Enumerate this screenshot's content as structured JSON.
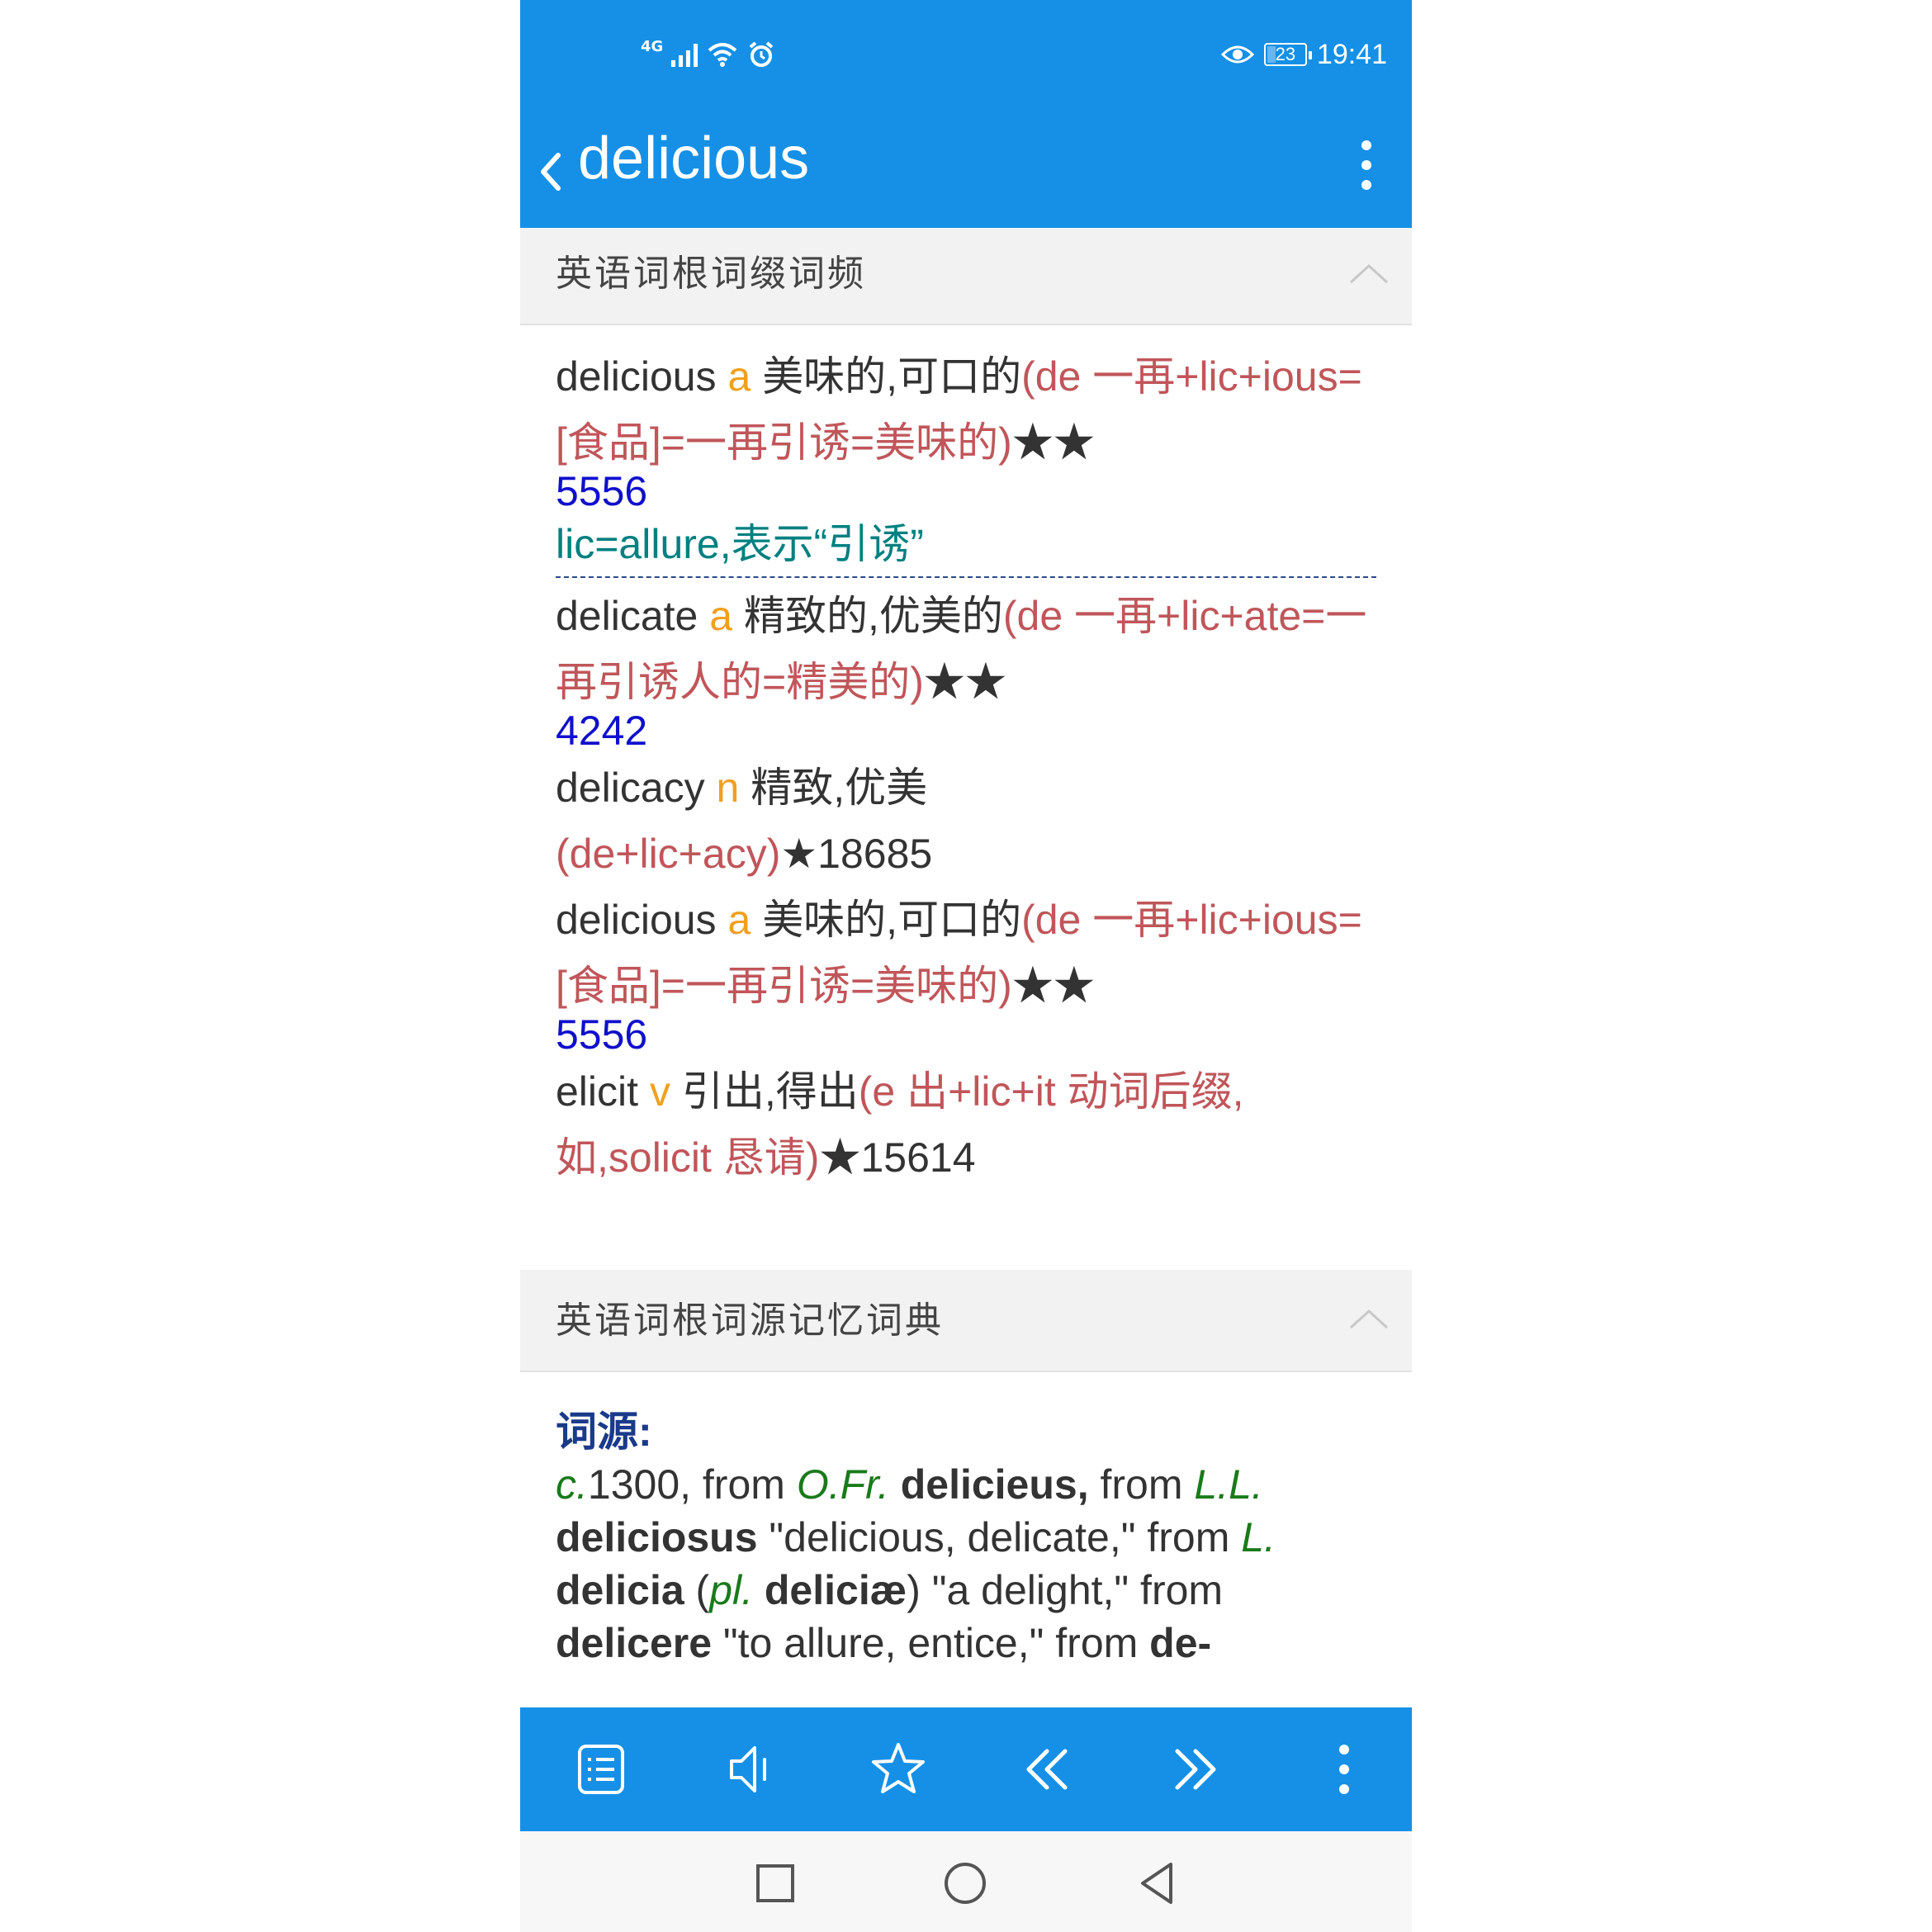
{
  "status_bar": {
    "network": "4G",
    "battery": "23",
    "time": "19:41"
  },
  "app_bar": {
    "title": "delicious"
  },
  "section1": {
    "title": "英语词根词缀词频",
    "entries": [
      {
        "word": "delicious",
        "pos": "a",
        "definition": "美味的,可口的",
        "etymology": "(de 一再+lic+ious=[食品]=一再引诱=美味的)",
        "stars": "★★",
        "frequency": "5556",
        "note": "lic=allure,表示“引诱”"
      },
      {
        "word": "delicate",
        "pos": "a",
        "definition": "精致的,优美的",
        "etymology": "(de 一再+lic+ate=一再引诱人的=精美的)",
        "stars": "★★",
        "frequency": "4242"
      },
      {
        "word": "delicacy",
        "pos": "n",
        "definition": "精致,优美",
        "etymology": "(de+lic+acy)",
        "stars": "★18685"
      },
      {
        "word": "delicious",
        "pos": "a",
        "definition": "美味的,可口的",
        "etymology": "(de 一再+lic+ious=[食品]=一再引诱=美味的)",
        "stars": "★★",
        "frequency": "5556"
      },
      {
        "word": "elicit",
        "pos": "v",
        "definition": "引出,得出",
        "etymology": "(e 出+lic+it 动词后缀,如,solicit 恳请)",
        "stars": "★15614"
      }
    ]
  },
  "section2": {
    "title": "英语词根词源记忆词典",
    "heading": "词源:",
    "t1": "c.",
    "t2": "1300, from ",
    "t3": "O.Fr.",
    "t4": " delicieus,",
    "t5": " from ",
    "t6": "L.L.",
    "t7": "deliciosus",
    "t8": " \"delicious, delicate,\" from ",
    "t9": "L.",
    "t10": "delicia",
    "t11": " (",
    "t12": "pl.",
    "t13": " deliciæ",
    "t14": ") \"a delight,\" from ",
    "t15": "delicere",
    "t16": " \"to allure, entice,\" from ",
    "t17": "de-"
  },
  "toolbar": {
    "icons": [
      "list-icon",
      "speaker-icon",
      "star-icon",
      "double-chevron-left-icon",
      "double-chevron-right-icon",
      "more-vertical-icon"
    ]
  },
  "nav": {
    "icons": [
      "recent-apps-icon",
      "home-icon",
      "back-triangle-icon"
    ]
  },
  "colors": {
    "primary": "#1590e6",
    "etymology": "#c0565a",
    "pos": "#f0a020",
    "frequency": "#1010cc",
    "note": "#008080"
  }
}
